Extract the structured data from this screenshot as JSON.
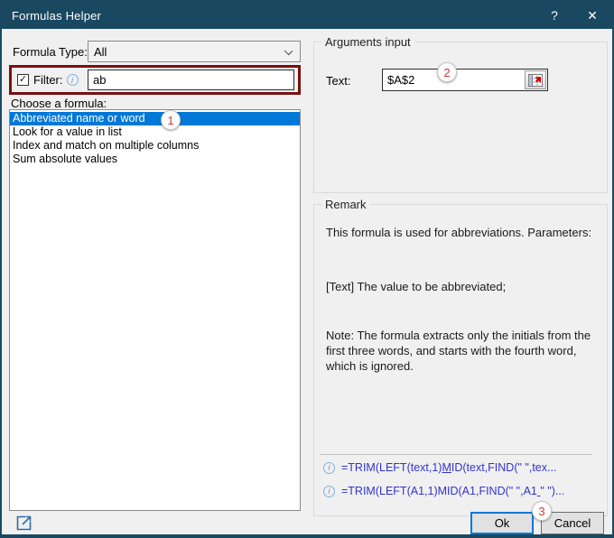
{
  "window": {
    "title": "Formulas Helper"
  },
  "icons": {
    "help": "?",
    "close": "✕",
    "check": "✓",
    "info": "i"
  },
  "left": {
    "formula_type_label": "Formula Type:",
    "formula_type_value": "All",
    "filter": {
      "label": "Filter:",
      "value": "ab"
    },
    "choose_label": "Choose a formula:",
    "formulas": [
      {
        "label": "Abbreviated name or word",
        "selected": true
      },
      {
        "label": "Look for a value in list",
        "selected": false
      },
      {
        "label": "Index and match on multiple columns",
        "selected": false
      },
      {
        "label": "Sum absolute values",
        "selected": false
      }
    ]
  },
  "arguments": {
    "group_label": "Arguments input",
    "text_label": "Text:",
    "text_value": "$A$2"
  },
  "remark": {
    "group_label": "Remark",
    "line1": "This formula is used for abbreviations. Parameters:",
    "line2": "[Text] The value to be abbreviated;",
    "line3": "Note: The formula extracts only the initials from the first three words, and starts with the fourth word, which is ignored.",
    "formulas": [
      {
        "pre": "=TRIM(LEFT(text,1)",
        "u": "M",
        "post": "ID(text,FIND(\" \",tex..."
      },
      {
        "pre": "=TRIM(LEFT(A1,1)MID(A1,FIND(\" \",A1",
        "u": " ",
        "post": "\" \")..."
      }
    ]
  },
  "footer": {
    "ok_label": "Ok",
    "cancel_label": "Cancel"
  },
  "annotations": {
    "step1": "1",
    "step2": "2",
    "step3": "3"
  },
  "colors": {
    "titlebar": "#1a4861",
    "selection": "#0078d7",
    "filter_highlight": "#7b0f0f",
    "annotation_red": "#cf3b3b",
    "formula_link": "#3333cc"
  }
}
